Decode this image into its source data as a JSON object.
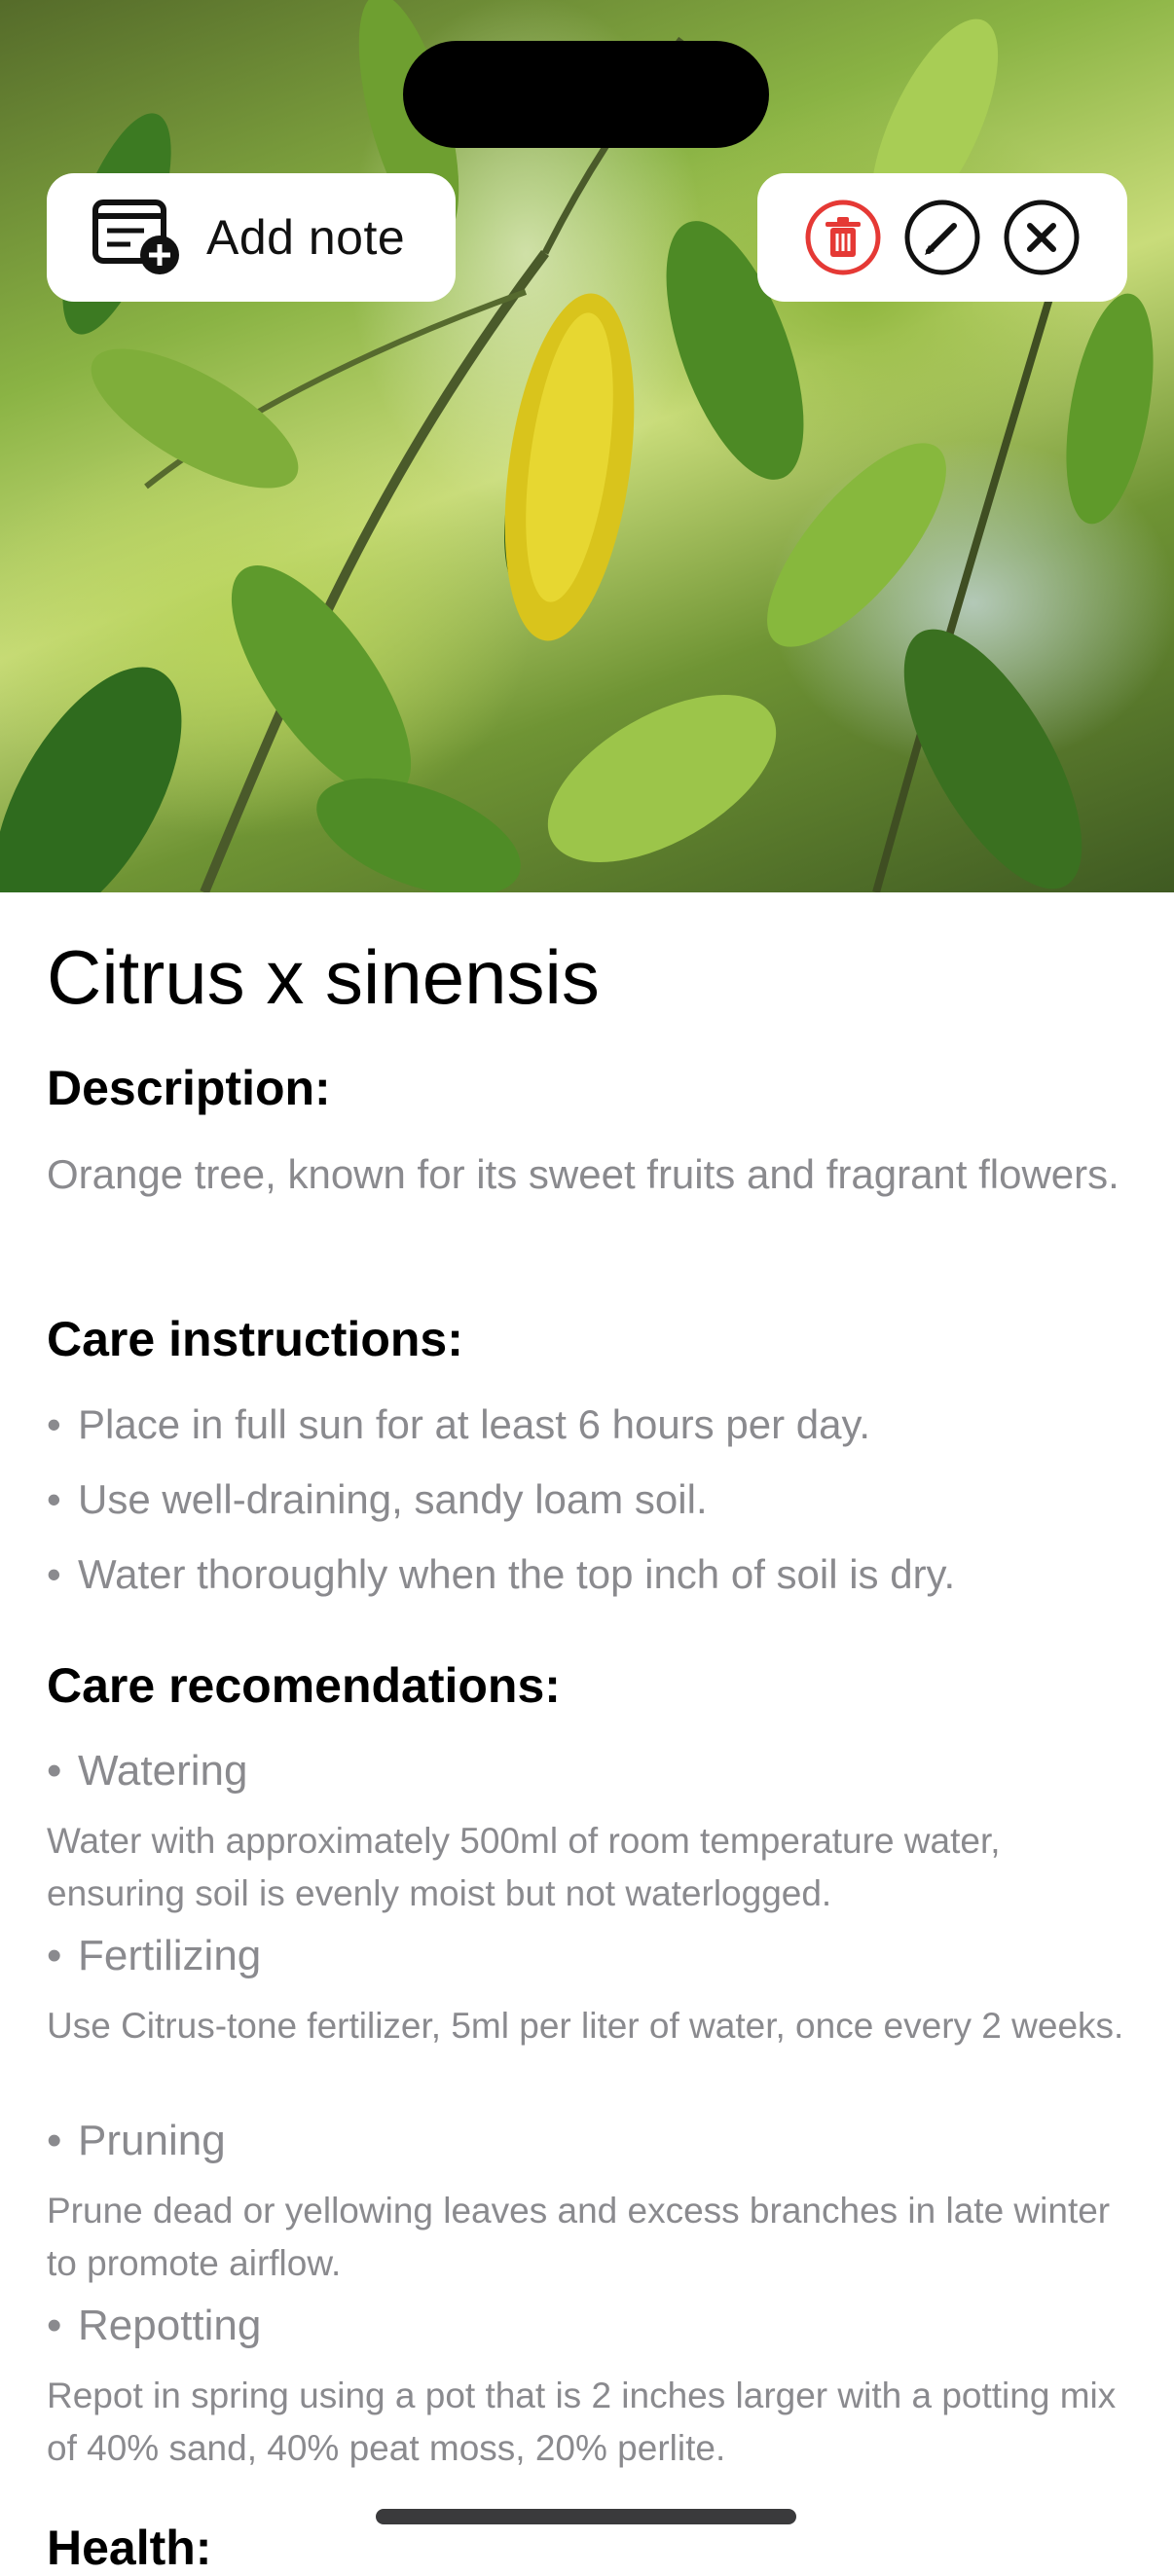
{
  "header": {
    "add_note_label": "Add note",
    "actions": [
      "trash-icon",
      "pencil-icon",
      "close-icon"
    ],
    "accent_delete": "#e53935"
  },
  "plant": {
    "name": "Citrus x sinensis",
    "description_heading": "Description:",
    "description": "Orange tree, known for its sweet fruits and fragrant flowers.",
    "care_heading": "Care instructions:",
    "care_instructions": [
      "Place in full sun for at least 6 hours per day.",
      "Use well-draining, sandy loam soil.",
      "Water thoroughly when the top inch of soil is dry."
    ],
    "recommendations_heading": "Care recomendations:",
    "recommendations": [
      {
        "title": "Watering",
        "text": "Water with approximately 500ml of room temperature water, ensuring soil is evenly moist but not waterlogged."
      },
      {
        "title": "Fertilizing",
        "text": "Use Citrus-tone fertilizer, 5ml per liter of water, once every 2 weeks."
      },
      {
        "title": "Pruning",
        "text": "Prune dead or yellowing leaves and excess branches in late winter to promote airflow."
      },
      {
        "title": "Repotting",
        "text": "Repot in spring using a pot that is 2 inches larger with a potting mix of 40% sand, 40% peat moss, 20% perlite."
      }
    ],
    "health_heading": "Health:"
  },
  "bullet_char": "•"
}
